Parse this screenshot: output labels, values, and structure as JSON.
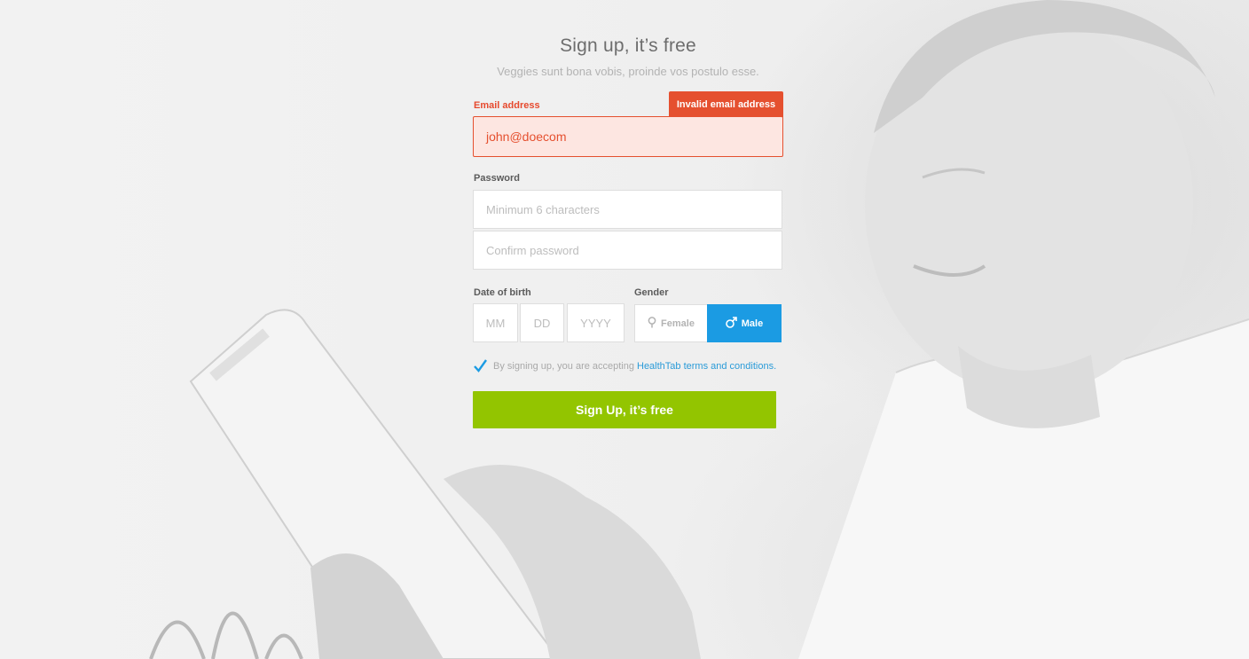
{
  "header": {
    "title": "Sign up, it’s free",
    "subtitle": "Veggies sunt bona vobis, proinde vos postulo esse."
  },
  "email": {
    "label": "Email address",
    "error": "Invalid email address",
    "value": "john@doecom"
  },
  "password": {
    "label": "Password",
    "placeholder": "Minimum 6 characters",
    "confirm_placeholder": "Confirm password"
  },
  "dob": {
    "label": "Date of birth",
    "month_placeholder": "MM",
    "day_placeholder": "DD",
    "year_placeholder": "YYYY"
  },
  "gender": {
    "label": "Gender",
    "female": "Female",
    "male": "Male",
    "selected": "Male"
  },
  "terms": {
    "checked": true,
    "text": "By signing up, you are accepting",
    "link": "HealthTab terms and conditions."
  },
  "submit": {
    "label": "Sign Up, it’s free"
  },
  "colors": {
    "error": "#e5502f",
    "accent_blue": "#1b9be3",
    "submit_green": "#93c500"
  }
}
